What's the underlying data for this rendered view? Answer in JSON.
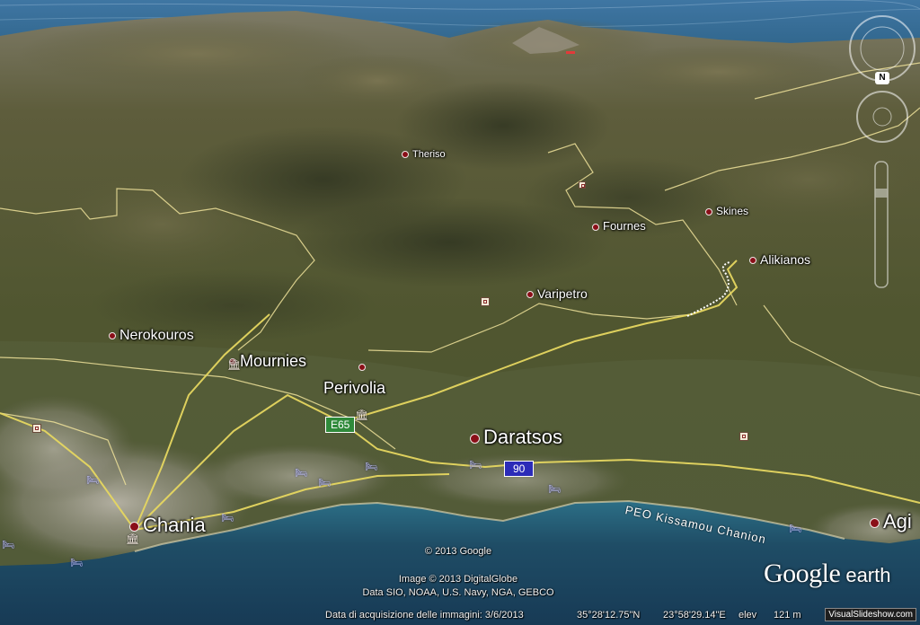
{
  "view": {
    "type": "satellite-3d",
    "colors": {
      "sea": "#3b6f96",
      "coast_water": "#2a5a74",
      "terrain": "#5a5a36",
      "urban": "#9a9688",
      "road": "#e6d760",
      "border": "#efe29a"
    }
  },
  "places": [
    {
      "label": "Theriso",
      "size": "small"
    },
    {
      "label": "Fournes",
      "size": "small"
    },
    {
      "label": "Skines",
      "size": "small"
    },
    {
      "label": "Alikianos",
      "size": "medium"
    },
    {
      "label": "Varipetro",
      "size": "medium"
    },
    {
      "label": "Nerokouros",
      "size": "large"
    },
    {
      "label": "Mournies",
      "size": "large"
    },
    {
      "label": "Perivolia",
      "size": "large"
    },
    {
      "label": "Daratsos",
      "size": "large"
    },
    {
      "label": "Chania",
      "size": "large"
    },
    {
      "label": "Agi",
      "size": "large"
    }
  ],
  "road_shields": [
    {
      "label": "E65",
      "color": "#2f8a3a"
    },
    {
      "label": "90",
      "color": "#2b2bb8"
    }
  ],
  "road_labels": [
    {
      "label": "PEO Kissamou Chanion"
    }
  ],
  "icons": {
    "hotel": "hotel-bed-icon",
    "museum": "museum-icon",
    "poi": "poi-square-icon",
    "compass": "compass-north-icon",
    "north": "N"
  },
  "credits": {
    "copyright": "© 2013 Google",
    "image": "Image © 2013 DigitalGlobe",
    "data": "Data SIO, NOAA, U.S. Navy, NGA, GEBCO"
  },
  "status": {
    "acquisition": "Data di acquisizione delle immagini: 3/6/2013",
    "lat": "35°28'12.75\"N",
    "lon": "23°58'29.14\"E",
    "elev_label": "elev",
    "elev_value": "121 m"
  },
  "brand": {
    "google": "Google",
    "earth": "earth"
  },
  "watermark": "VisualSlideshow.com"
}
